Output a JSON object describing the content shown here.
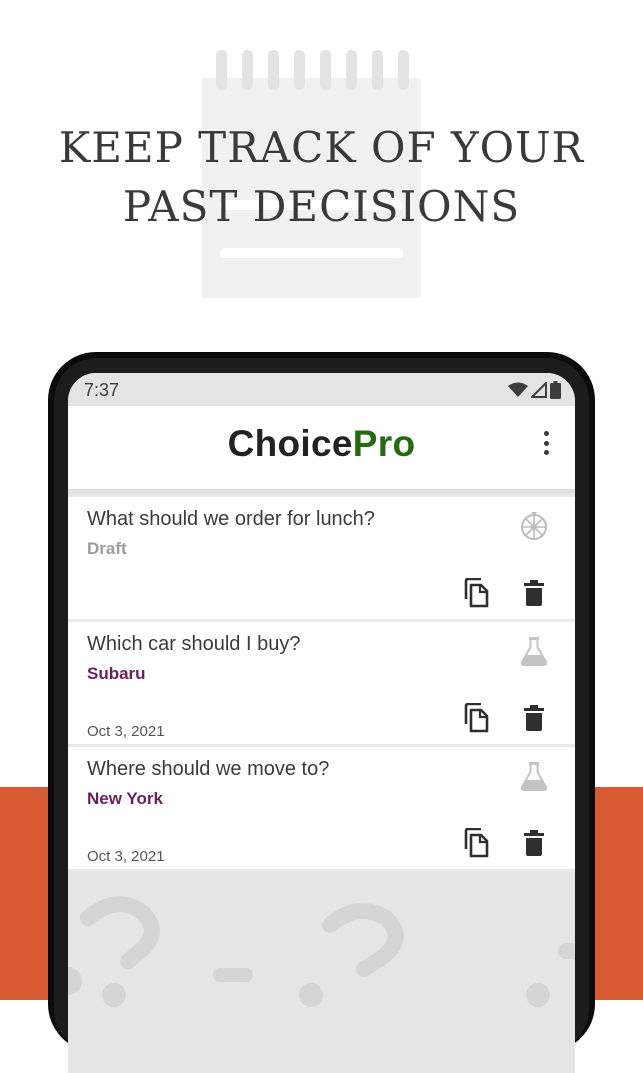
{
  "headline": {
    "line1": "KEEP TRACK OF YOUR",
    "line2": "PAST DECISIONS"
  },
  "colors": {
    "accent_orange": "#d85a33",
    "brand_green": "#256b12",
    "answer_purple": "#6d1f5c",
    "draft_gray": "#9c9c9c"
  },
  "status_bar": {
    "time": "7:37",
    "icons": [
      "wifi-icon",
      "signal-icon",
      "battery-icon"
    ]
  },
  "app_bar": {
    "title_part1": "Choice",
    "title_part2": "Pro",
    "menu_icon": "more-vert-icon"
  },
  "decisions": [
    {
      "question": "What should we order for lunch?",
      "answer": "Draft",
      "date": "",
      "type_icon": "wheel-icon"
    },
    {
      "question": "Which car should I buy?",
      "answer": "Subaru",
      "date": "Oct 3, 2021",
      "type_icon": "flask-icon"
    },
    {
      "question": "Where should we move to?",
      "answer": "New York",
      "date": "Oct 3, 2021",
      "type_icon": "flask-icon"
    }
  ]
}
